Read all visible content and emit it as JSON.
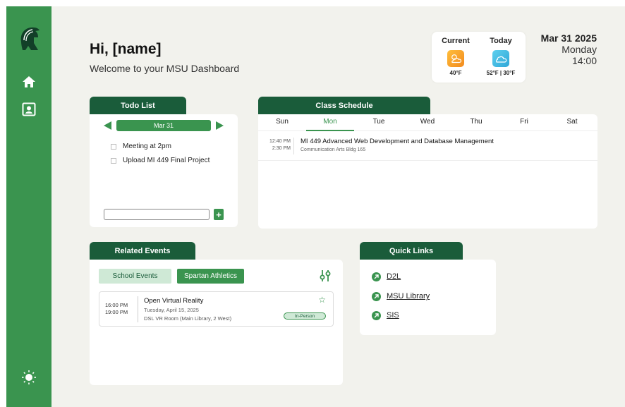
{
  "header": {
    "greeting": "Hi, [name]",
    "welcome": "Welcome to your MSU Dashboard"
  },
  "weather": {
    "current_label": "Current",
    "current_temp": "40°F",
    "today_label": "Today",
    "today_temp": "52°F | 30°F",
    "current_icon": "partly-cloudy-icon",
    "today_icon": "cloud-icon"
  },
  "datetime": {
    "date": "Mar 31 2025",
    "weekday": "Monday",
    "time": "14:00"
  },
  "todo": {
    "title": "Todo List",
    "date": "Mar 31",
    "items": [
      {
        "label": "Meeting at 2pm"
      },
      {
        "label": "Upload MI 449 Final Project"
      }
    ],
    "input_placeholder": "",
    "add_label": "+"
  },
  "schedule": {
    "title": "Class Schedule",
    "days": [
      "Sun",
      "Mon",
      "Tue",
      "Wed",
      "Thu",
      "Fri",
      "Sat"
    ],
    "active_day": "Mon",
    "classes": [
      {
        "start": "12:40 PM",
        "end": "2:30 PM",
        "title": "MI 449 Advanced Web Development and Database Management",
        "location": "Communication Arts Bldg 165"
      }
    ]
  },
  "events": {
    "title": "Related Events",
    "filters": [
      "School Events",
      "Spartan Athletics"
    ],
    "items": [
      {
        "start": "16:00 PM",
        "end": "19:00 PM",
        "title": "Open Virtual Reality",
        "date": "Tuesday, April 15, 2025",
        "location": "DSL VR Room (Main Library, 2 West)",
        "badge": "In-Person"
      }
    ]
  },
  "quick_links": {
    "title": "Quick Links",
    "items": [
      "D2L",
      "MSU Library",
      "SIS"
    ]
  },
  "colors": {
    "sidebar": "#3a944f",
    "tab": "#1a5c3a",
    "background": "#f2f2ed"
  }
}
